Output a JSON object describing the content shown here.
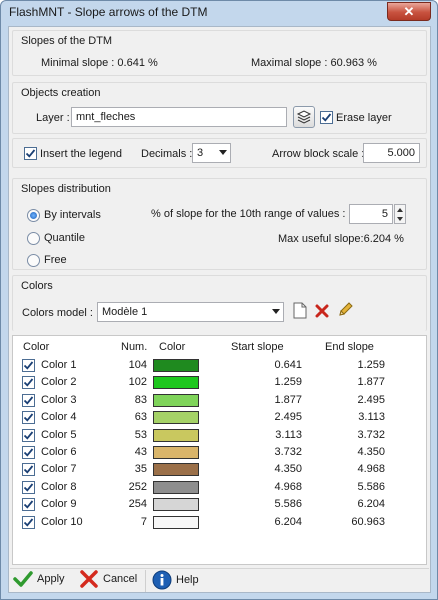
{
  "window": {
    "title": "FlashMNT - Slope arrows of the DTM",
    "close_label": "✕"
  },
  "slopes_of_dtm": {
    "title": "Slopes of the DTM",
    "minimal_label": "Minimal slope : 0.641 %",
    "maximal_label": "Maximal slope : 60.963 %"
  },
  "objects_creation": {
    "title": "Objects creation",
    "layer_label": "Layer :",
    "layer_value": "mnt_fleches",
    "erase_layer_label": "Erase layer",
    "erase_layer_checked": true
  },
  "options": {
    "insert_legend_label": "Insert the legend",
    "insert_legend_checked": true,
    "decimals_label": "Decimals :",
    "decimals_value": "3",
    "arrow_scale_label": "Arrow block scale :",
    "arrow_scale_value": "5.000"
  },
  "slopes_distribution": {
    "title": "Slopes distribution",
    "radio_by_intervals": "By intervals",
    "radio_quantile": "Quantile",
    "radio_free": "Free",
    "selected": "By intervals",
    "range_label": "% of slope for the 10th range of values :",
    "range_value": "5",
    "max_useful_label": "Max useful slope:6.204 %"
  },
  "colors": {
    "title": "Colors",
    "model_label": "Colors model :",
    "model_value": "Modèle 1",
    "table_headers": [
      "Color",
      "Num.",
      "Color",
      "Start slope",
      "End slope"
    ],
    "rows": [
      {
        "name": "Color 1",
        "num": "104",
        "swatch": "#1f8a1f",
        "start": "0.641",
        "end": "1.259"
      },
      {
        "name": "Color 2",
        "num": "102",
        "swatch": "#1ec81e",
        "start": "1.259",
        "end": "1.877"
      },
      {
        "name": "Color 3",
        "num": "83",
        "swatch": "#7fd45a",
        "start": "1.877",
        "end": "2.495"
      },
      {
        "name": "Color 4",
        "num": "63",
        "swatch": "#a5d267",
        "start": "2.495",
        "end": "3.113"
      },
      {
        "name": "Color 5",
        "num": "53",
        "swatch": "#c9c85f",
        "start": "3.113",
        "end": "3.732"
      },
      {
        "name": "Color 6",
        "num": "43",
        "swatch": "#d9b56a",
        "start": "3.732",
        "end": "4.350"
      },
      {
        "name": "Color 7",
        "num": "35",
        "swatch": "#9b7049",
        "start": "4.350",
        "end": "4.968"
      },
      {
        "name": "Color 8",
        "num": "252",
        "swatch": "#8e8e8e",
        "start": "4.968",
        "end": "5.586"
      },
      {
        "name": "Color 9",
        "num": "254",
        "swatch": "#d6d6d6",
        "start": "5.586",
        "end": "6.204"
      },
      {
        "name": "Color 10",
        "num": "7",
        "swatch": "#f7f7f7",
        "start": "6.204",
        "end": "60.963"
      }
    ]
  },
  "buttons": {
    "apply": "Apply",
    "cancel": "Cancel",
    "help": "Help"
  }
}
